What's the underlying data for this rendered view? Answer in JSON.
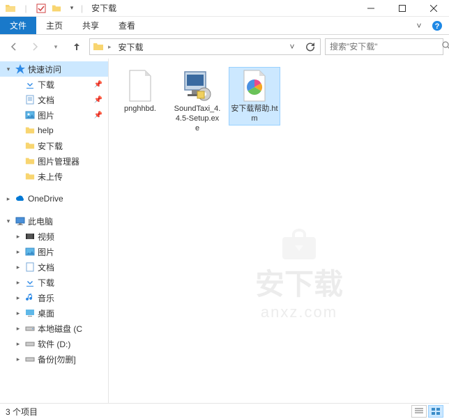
{
  "titlebar": {
    "title": "安下载"
  },
  "ribbon": {
    "file": "文件",
    "tabs": [
      "主页",
      "共享",
      "查看"
    ]
  },
  "nav": {
    "crumb": "安下载",
    "search_placeholder": "搜索\"安下载\""
  },
  "sidebar": {
    "quick_access": "快速访问",
    "items_qa": [
      {
        "label": "下载",
        "icon": "download",
        "pinned": true
      },
      {
        "label": "文档",
        "icon": "document",
        "pinned": true
      },
      {
        "label": "图片",
        "icon": "pictures",
        "pinned": true
      },
      {
        "label": "help",
        "icon": "folder",
        "pinned": false
      },
      {
        "label": "安下载",
        "icon": "folder",
        "pinned": false
      },
      {
        "label": "图片管理器",
        "icon": "folder",
        "pinned": false
      },
      {
        "label": "未上传",
        "icon": "folder",
        "pinned": false
      }
    ],
    "onedrive": "OneDrive",
    "this_pc": "此电脑",
    "items_pc": [
      {
        "label": "视频",
        "icon": "video"
      },
      {
        "label": "图片",
        "icon": "pictures"
      },
      {
        "label": "文档",
        "icon": "document"
      },
      {
        "label": "下载",
        "icon": "download"
      },
      {
        "label": "音乐",
        "icon": "music"
      },
      {
        "label": "桌面",
        "icon": "desktop"
      },
      {
        "label": "本地磁盘 (C",
        "icon": "drive"
      },
      {
        "label": "软件 (D:)",
        "icon": "drive"
      },
      {
        "label": "备份[勿删]",
        "icon": "drive"
      }
    ]
  },
  "files": [
    {
      "label": "pnghhbd.",
      "icon": "file"
    },
    {
      "label": "SoundTaxi_4.4.5-Setup.exe",
      "icon": "installer"
    },
    {
      "label": "安下载帮助.htm",
      "icon": "htm",
      "selected": true
    }
  ],
  "statusbar": {
    "items": "3 个项目"
  },
  "watermark": {
    "text": "安下载",
    "url": "anxz.com"
  }
}
